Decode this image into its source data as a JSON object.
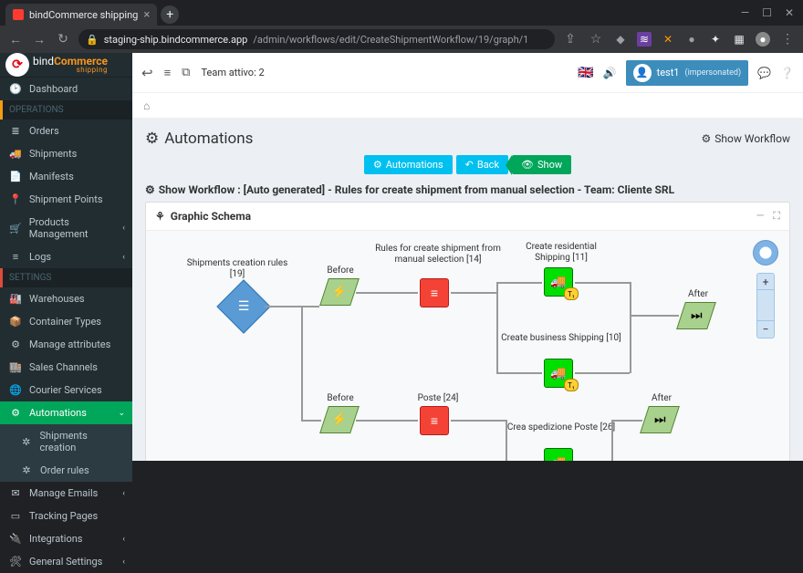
{
  "browser": {
    "tab_title": "bindCommerce shipping",
    "url_host": "staging-ship.bindcommerce.app",
    "url_path": "/admin/workflows/edit/CreateShipmentWorkflow/19/graph/1"
  },
  "brand": {
    "line1a": "bind",
    "line1b": "Commerce",
    "line2": "shipping"
  },
  "topbar": {
    "team_label": "Team attivo: 2",
    "user_name": "test1",
    "user_status": "(impersonated)"
  },
  "sidebar": {
    "dashboard": "Dashboard",
    "header_ops": "OPERATIONS",
    "orders": "Orders",
    "shipments": "Shipments",
    "manifests": "Manifests",
    "shipment_points": "Shipment Points",
    "products": "Products Management",
    "logs": "Logs",
    "header_settings": "SETTINGS",
    "warehouses": "Warehouses",
    "container_types": "Container Types",
    "manage_attributes": "Manage attributes",
    "sales_channels": "Sales Channels",
    "courier_services": "Courier Services",
    "automations": "Automations",
    "shipments_creation": "Shipments creation",
    "order_rules": "Order rules",
    "manage_emails": "Manage Emails",
    "tracking_pages": "Tracking Pages",
    "integrations": "Integrations",
    "general_settings": "General Settings"
  },
  "page": {
    "title": "Automations",
    "show_workflow": "Show Workflow",
    "btn_automations": "Automations",
    "btn_back": "Back",
    "btn_show": "Show",
    "subtitle": "Show Workflow : [Auto generated] - Rules for create shipment from manual selection - Team: Cliente SRL",
    "panel_title": "Graphic Schema"
  },
  "graph": {
    "n_rules_root": "Shipments creation rules\n[19]",
    "n_before1": "Before",
    "n_rules_manual": "Rules for create shipment\nfrom manual selection\n[14]",
    "n_res_ship": "Create residential\nShipping [11]",
    "n_after1": "After",
    "n_bus_ship": "Create business Shipping\n[10]",
    "n_before2": "Before",
    "n_poste": "Poste [24]",
    "n_after2": "After",
    "n_sped_poste": "Crea spedizione Poste\n[26]"
  }
}
